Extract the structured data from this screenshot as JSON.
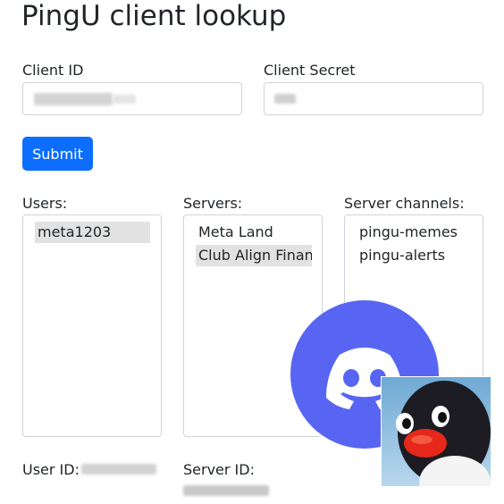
{
  "page": {
    "title": "PingU client lookup"
  },
  "form": {
    "client_id_label": "Client ID",
    "client_secret_label": "Client Secret",
    "submit_label": "Submit"
  },
  "lists": {
    "users_label": "Users:",
    "servers_label": "Servers:",
    "channels_label": "Server channels:",
    "users": [
      "meta1203"
    ],
    "servers": [
      "Meta Land",
      "Club Align Financial"
    ],
    "channels": [
      "pingu-memes",
      "pingu-alerts"
    ]
  },
  "footer": {
    "user_id_label": "User ID:",
    "server_id_label": "Server ID:"
  },
  "icons": {
    "discord": "discord-logo-icon",
    "avatar": "pingu-avatar"
  },
  "colors": {
    "accent": "#0d6efd",
    "discord": "#5865f2",
    "selected": "#e2e2e2"
  }
}
